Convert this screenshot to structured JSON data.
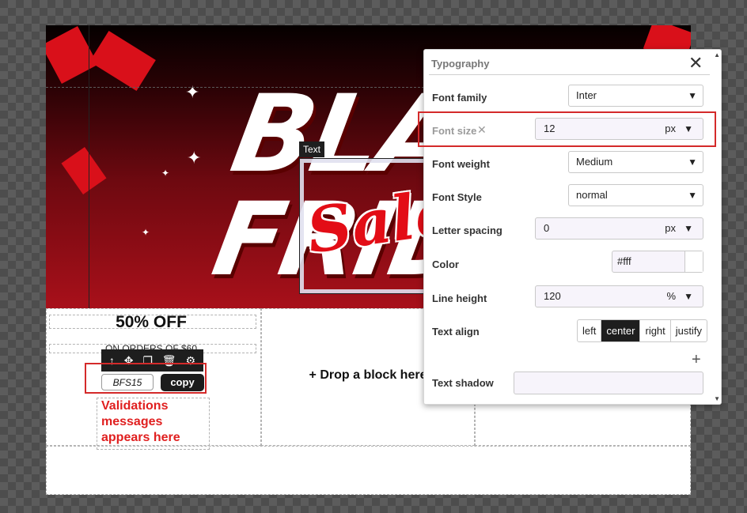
{
  "banner": {
    "word1": "BLAC",
    "word2": "FRID",
    "sale": "Sale",
    "text_label": "Text"
  },
  "block": {
    "offer_title": "50% OFF",
    "orders_text": "ON ORDERS OF $60",
    "toolbar_icons": [
      "arrow-up-icon",
      "move-icon",
      "duplicate-icon",
      "trash-icon",
      "gear-icon"
    ],
    "coupon_code": "BFS15",
    "copy_label": "copy",
    "validation_message": "Validations messages appears here"
  },
  "drop_zone": {
    "text": "+ Drop a block here"
  },
  "typography": {
    "title": "Typography",
    "close_glyph": "✕",
    "font_family": {
      "label": "Font family",
      "value": "Inter"
    },
    "font_size": {
      "label": "Font size",
      "clear_glyph": "✕",
      "value": "12",
      "unit": "px"
    },
    "font_weight": {
      "label": "Font weight",
      "value": "Medium"
    },
    "font_style": {
      "label": "Font Style",
      "value": "normal"
    },
    "letter_spacing": {
      "label": "Letter spacing",
      "value": "0",
      "unit": "px"
    },
    "color": {
      "label": "Color",
      "value": "#fff"
    },
    "line_height": {
      "label": "Line height",
      "value": "120",
      "unit": "%"
    },
    "text_align": {
      "label": "Text align",
      "options": [
        "left",
        "center",
        "right",
        "justify"
      ],
      "selected": "center"
    },
    "text_shadow": {
      "label": "Text shadow",
      "add_glyph": "+"
    }
  }
}
